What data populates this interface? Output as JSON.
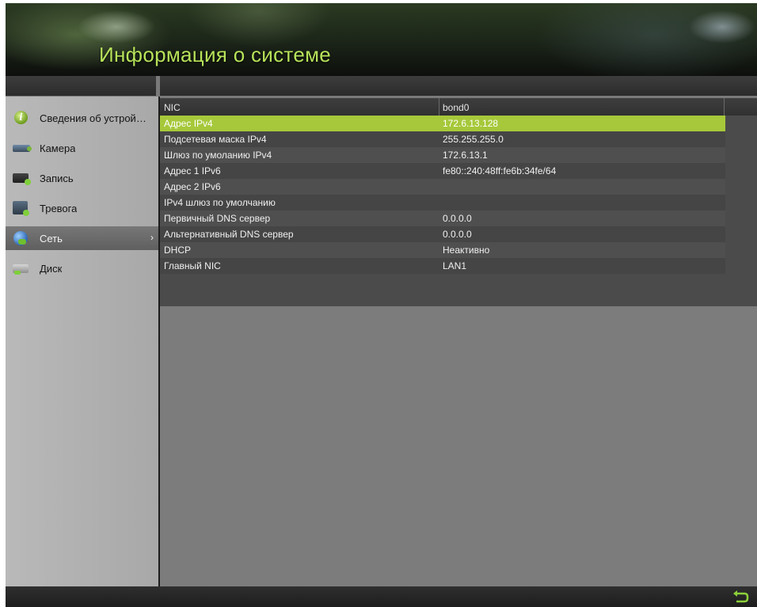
{
  "header": {
    "title": "Информация о системе"
  },
  "sidebar": {
    "items": [
      {
        "label": "Сведения об устройст...",
        "icon": "info-icon"
      },
      {
        "label": "Камера",
        "icon": "camera-icon"
      },
      {
        "label": "Запись",
        "icon": "record-icon"
      },
      {
        "label": "Тревога",
        "icon": "alarm-icon"
      },
      {
        "label": "Сеть",
        "icon": "network-icon",
        "active": true
      },
      {
        "label": "Диск",
        "icon": "disk-icon"
      }
    ],
    "active_arrow": "›"
  },
  "table": {
    "headers": [
      "NIC",
      "bond0"
    ],
    "rows": [
      {
        "name": "Адрес IPv4",
        "value": "172.6.13.128"
      },
      {
        "name": "Подсетевая маска IPv4",
        "value": "255.255.255.0"
      },
      {
        "name": "Шлюз по умоланию IPv4",
        "value": "172.6.13.1"
      },
      {
        "name": "Адрес 1 IPv6",
        "value": "fe80::240:48ff:fe6b:34fe/64"
      },
      {
        "name": "Адрес 2 IPv6",
        "value": ""
      },
      {
        "name": "IPv4 шлюз по умолчанию",
        "value": ""
      },
      {
        "name": "Первичный DNS сервер",
        "value": "0.0.0.0"
      },
      {
        "name": "Альтернативный DNS сервер",
        "value": "0.0.0.0"
      },
      {
        "name": "DHCP",
        "value": "Неактивно"
      },
      {
        "name": "Главный NIC",
        "value": "LAN1"
      }
    ]
  },
  "colors": {
    "accent": "#a6c83a",
    "title": "#b7e35a"
  },
  "bottom_bar": {
    "back_icon": "back-arrow-icon"
  }
}
